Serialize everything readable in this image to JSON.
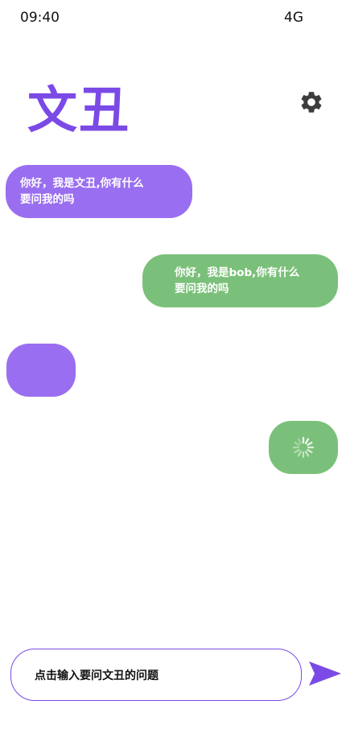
{
  "status_bar": {
    "time": "09:40",
    "network": "4G"
  },
  "header": {
    "title": "文丑",
    "settings_icon": "gear-icon"
  },
  "colors": {
    "brand": "#7b4ae6",
    "bot_bubble": "#9a6ef0",
    "user_bubble": "#7bc07a"
  },
  "messages": [
    {
      "sender": "bot",
      "text": "你好，我是文丑,你有什么\n要问我的吗"
    },
    {
      "sender": "user",
      "text": "你好，我是bob,你有什么\n要问我的吗"
    },
    {
      "sender": "bot",
      "text": ""
    },
    {
      "sender": "user",
      "text": "",
      "status": "loading",
      "icon": "loading-spinner-icon"
    }
  ],
  "composer": {
    "placeholder": "点击输入要问文丑的问题",
    "send_icon": "send-icon"
  }
}
